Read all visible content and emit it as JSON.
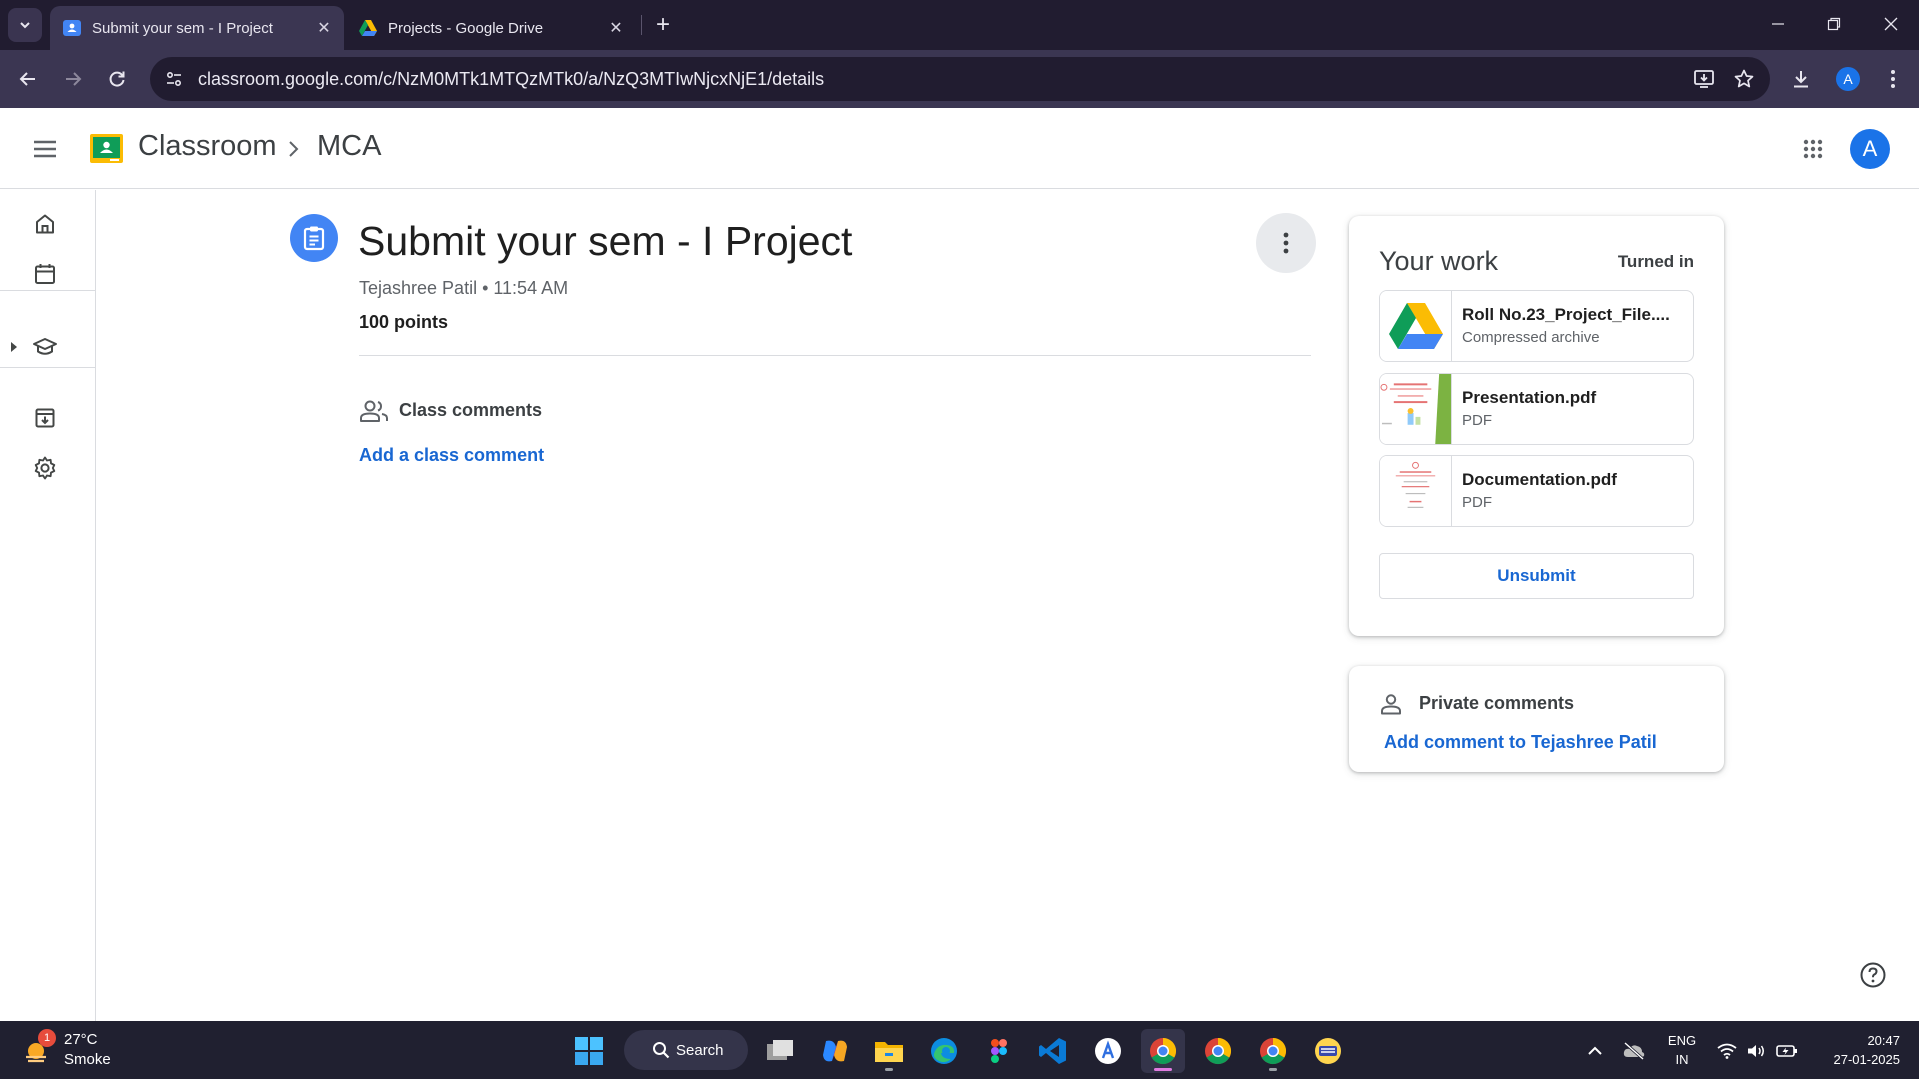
{
  "browser": {
    "tabs": [
      {
        "title": "Submit your sem - I Project",
        "active": true
      },
      {
        "title": "Projects - Google Drive",
        "active": false
      }
    ],
    "url": "classroom.google.com/c/NzM0MTk1MTQzMTk0/a/NzQ3MTIwNjcxNjE1/details",
    "profile_initial": "A"
  },
  "header": {
    "app_name": "Classroom",
    "class_name": "MCA",
    "avatar_initial": "A"
  },
  "rail": {
    "items": [
      "home-icon",
      "calendar-icon",
      "enrolled-icon",
      "todo-icon",
      "settings-icon"
    ]
  },
  "post": {
    "title": "Submit your sem - I Project",
    "meta": "Tejashree Patil • 11:54 AM",
    "points": "100 points",
    "class_comments_label": "Class comments",
    "add_class_comment": "Add a class comment"
  },
  "work": {
    "title": "Your work",
    "status": "Turned in",
    "attachments": [
      {
        "name": "Roll No.23_Project_File....",
        "type": "Compressed archive",
        "icon": "google-drive-icon"
      },
      {
        "name": "Presentation.pdf",
        "type": "PDF",
        "icon": "pdf-thumbnail"
      },
      {
        "name": "Documentation.pdf",
        "type": "PDF",
        "icon": "pdf-thumbnail"
      }
    ],
    "unsubmit_label": "Unsubmit"
  },
  "private_comments": {
    "label": "Private comments",
    "add": "Add comment to Tejashree Patil"
  },
  "taskbar": {
    "weather_temp": "27°C",
    "weather_cond": "Smoke",
    "weather_badge": "1",
    "search_label": "Search",
    "lang_top": "ENG",
    "lang_bottom": "IN",
    "time": "20:47",
    "date": "27-01-2025"
  },
  "colors": {
    "accent": "#1967d2",
    "assignment_icon": "#4285f4",
    "browser_frame": "#211c30",
    "toolbar": "#3b3652",
    "taskbar": "#202030"
  }
}
